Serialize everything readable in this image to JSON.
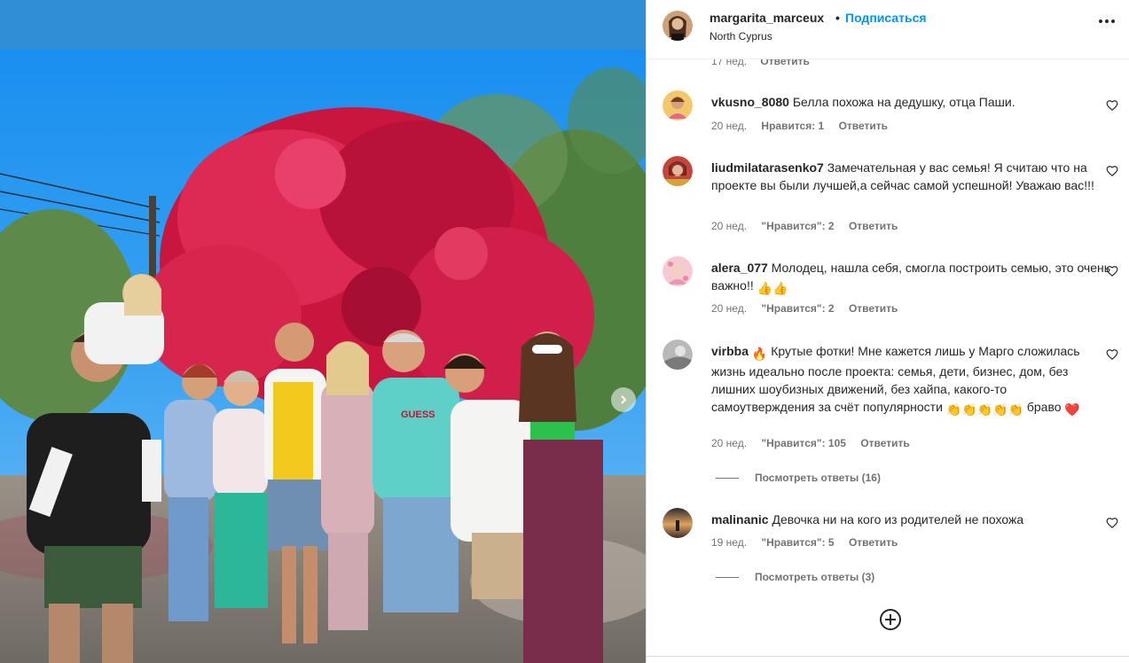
{
  "post": {
    "owner": "margarita_marceux",
    "separator": "•",
    "follow_label": "Подписаться",
    "location": "North Cyprus",
    "more_icon": "more-horizontal-icon"
  },
  "ghost_meta": {
    "time": "17 нед.",
    "reply_label": "Ответить"
  },
  "comments": [
    {
      "username": "vkusno_8080",
      "text": "Белла похожа на дедушку, отца Паши.",
      "time": "20 нед.",
      "likes": "Нравится: 1",
      "reply_label": "Ответить"
    },
    {
      "username": "liudmilatarasenko7",
      "text": "Замечательная у вас семья! Я считаю что на проекте вы были лучшей,а сейчас самой успешной! Уважаю вас!!!",
      "time": "20 нед.",
      "likes": "\"Нравится\": 2",
      "reply_label": "Ответить"
    },
    {
      "username": "alera_077",
      "text": "Молодец, нашла себя, смогла построить семью, это очень важно!!",
      "emoji_after": "👍👍",
      "time": "20 нед.",
      "likes": "\"Нравится\": 2",
      "reply_label": "Ответить"
    },
    {
      "username": "virbba",
      "text_a": "🔥",
      "text_b": "Крутые фотки! Мне кажется лишь у Марго сложилась жизнь идеально после проекта: семья, дети, бизнес, дом, без лишних шоубизных движений, без хайпа, какого-то самоутверждения за счёт популярности",
      "text_c": "👏👏👏👏👏",
      "text_d": "браво",
      "text_e": "❤️",
      "time": "20 нед.",
      "likes": "\"Нравится\": 105",
      "reply_label": "Ответить",
      "replies_label": "Посмотреть ответы (16)"
    },
    {
      "username": "malinanic",
      "text": "Девочка ни на кого из родителей не похожа",
      "time": "19 нед.",
      "likes": "\"Нравится\": 5",
      "reply_label": "Ответить",
      "replies_label": "Посмотреть ответы (3)"
    }
  ],
  "icons": {
    "like": "heart-outline-icon",
    "load_more": "plus-circle-icon",
    "next": "chevron-right-icon"
  },
  "colors": {
    "accent": "#0095f6",
    "secondary_text": "#737373",
    "primary_text": "#262626",
    "border": "#dbdbdb"
  }
}
